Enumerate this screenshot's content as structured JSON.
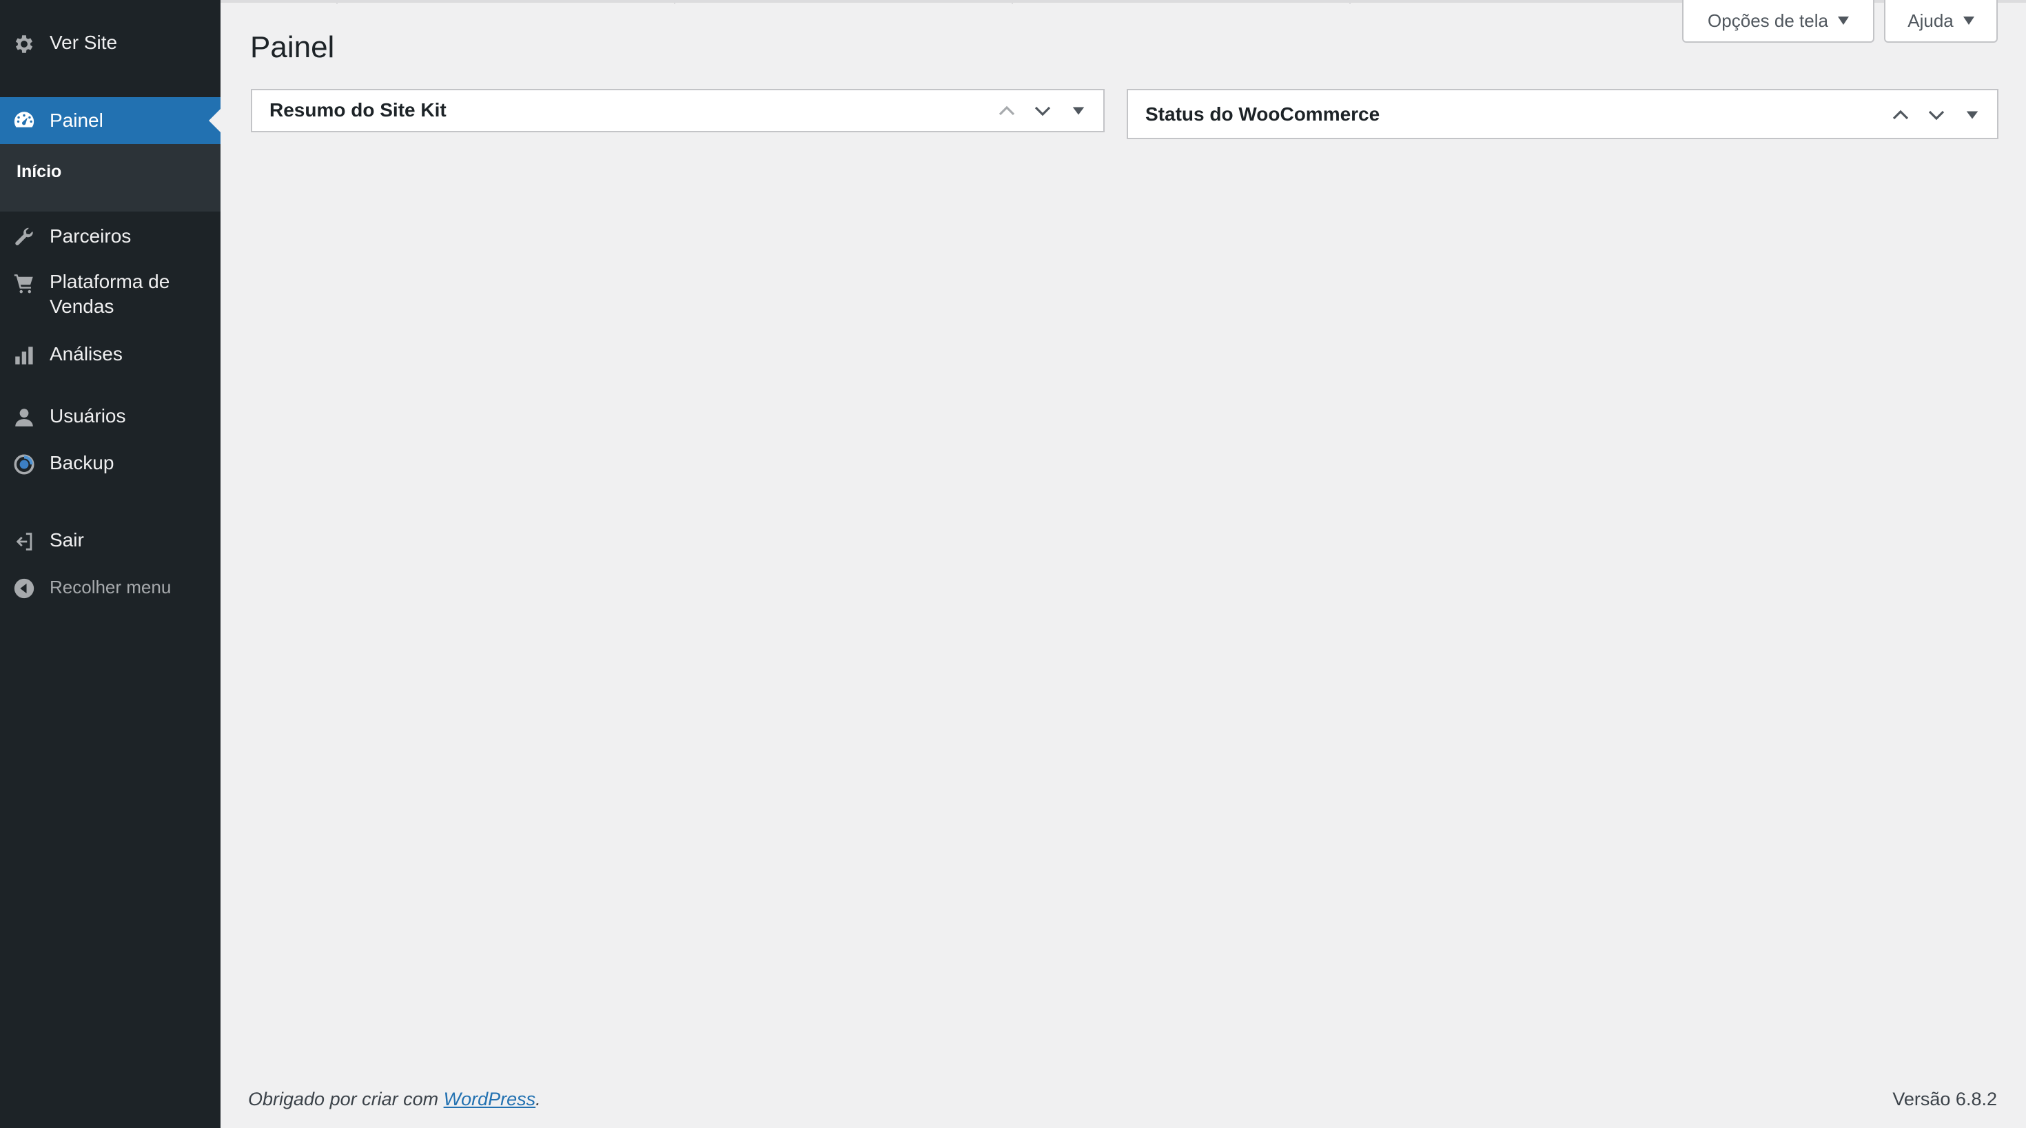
{
  "sidebar": {
    "ver_site": "Ver Site",
    "painel": "Painel",
    "submenu_inicio": "Início",
    "parceiros": "Parceiros",
    "plataforma": "Plataforma de Vendas",
    "analises": "Análises",
    "usuarios": "Usuários",
    "backup": "Backup",
    "sair": "Sair",
    "recolher": "Recolher menu"
  },
  "header": {
    "screen_options": "Opções de tela",
    "help": "Ajuda"
  },
  "page": {
    "title": "Painel"
  },
  "widgets": {
    "sitekit_title": "Resumo do Site Kit",
    "woo_title": "Status do WooCommerce"
  },
  "footer": {
    "thanks_prefix": "Obrigado por criar com ",
    "thanks_link": "WordPress",
    "thanks_suffix": ".",
    "version": "Versão 6.8.2"
  },
  "colors": {
    "sidebar_bg": "#1d2327",
    "active_item": "#2271b1",
    "submenu_bg": "#2c3338",
    "page_bg": "#f0f0f1"
  }
}
